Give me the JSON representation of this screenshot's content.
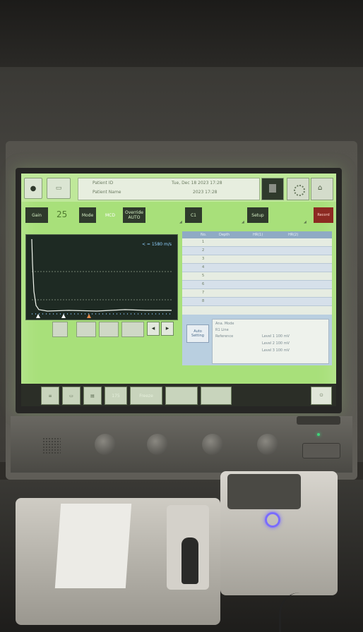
{
  "top_bar": {
    "patient_line": "Patient ID",
    "name_line": "Patient Name",
    "date_line": "Tue, Dec 18 2023  17:28",
    "sub_line": "2023  17:28"
  },
  "controls": {
    "gain_label": "Gain",
    "gain_value": "25",
    "mode_label": "Mode",
    "mode_value": "MCD",
    "override_label": "Override AUTO",
    "c1_label": "C1",
    "setup_label": "Setup",
    "record_label": "Record"
  },
  "waveform": {
    "scale_text": "< = 1580 m/s"
  },
  "table": {
    "headers": [
      "No.",
      "Depth",
      "HR(1)",
      "HR(2)"
    ],
    "rows": [
      "1",
      "2",
      "3",
      "4",
      "5",
      "6",
      "7",
      "8"
    ]
  },
  "details": {
    "button_label": "Auto Setting",
    "lines": [
      "Ana. Mode",
      "R1 Line",
      "Reference",
      "Level 1 100 mV",
      "Level 2 100 mV",
      "Level 3 100 mV"
    ]
  },
  "bottom": {
    "btn_1": "175",
    "btn_2": "Freeze"
  }
}
